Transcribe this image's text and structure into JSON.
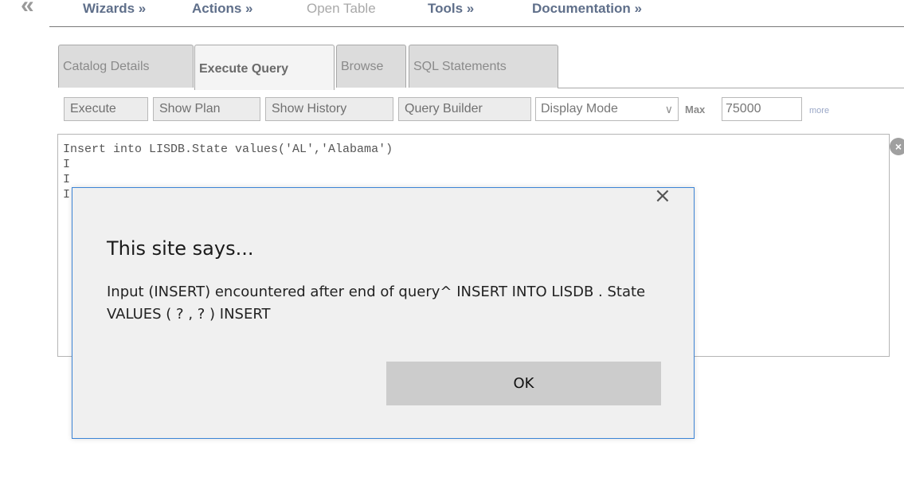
{
  "menu": {
    "items": [
      {
        "label": "Wizards »",
        "disabled": false
      },
      {
        "label": "Actions »",
        "disabled": false
      },
      {
        "label": "Open Table",
        "disabled": true
      },
      {
        "label": "Tools »",
        "disabled": false
      },
      {
        "label": "Documentation »",
        "disabled": false
      }
    ],
    "collapse_icon": "«"
  },
  "tabs": [
    {
      "label": "Catalog Details",
      "active": false
    },
    {
      "label": "Execute Query",
      "active": true
    },
    {
      "label": "Browse",
      "active": false
    },
    {
      "label": "SQL Statements",
      "active": false
    }
  ],
  "toolbar": {
    "execute_label": "Execute",
    "show_plan_label": "Show Plan",
    "show_history_label": "Show History",
    "query_builder_label": "Query Builder",
    "display_mode_value": "Display Mode",
    "max_label": "Max",
    "max_value": "75000",
    "more_label": "more"
  },
  "editor": {
    "lines": [
      "Insert into LISDB.State values('AL','Alabama')",
      "I",
      "I",
      "I"
    ]
  },
  "dialog": {
    "close_glyph": "×",
    "title": "This site says...",
    "message": "Input (INSERT) encountered after end of query^ INSERT INTO LISDB . State VALUES ( ? , ? ) INSERT",
    "ok_label": "OK"
  },
  "colors": {
    "accent": "#3c84d6",
    "tab_bg": "#dcdcdc",
    "button_bg": "#ececec",
    "dialog_bg": "#f0f0f0",
    "ok_bg": "#cccccc"
  }
}
